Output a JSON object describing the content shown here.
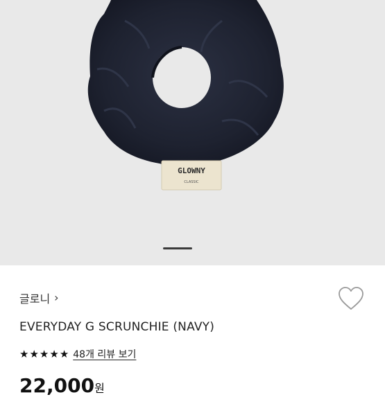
{
  "product_image": {
    "label_brand": "GLOWNY",
    "label_sub": "CLASSIC"
  },
  "carousel": {
    "current": 1
  },
  "brand": {
    "name": "글로니",
    "chevron": "›"
  },
  "wishlist": {
    "icon": "heart-outline-icon"
  },
  "product": {
    "title": "EVERYDAY G SCRUNCHIE (NAVY)"
  },
  "rating": {
    "stars": 5,
    "star_glyph": "★",
    "reviews_link": "48개 리뷰 보기"
  },
  "price": {
    "amount": "22,000",
    "currency": "원"
  },
  "colors": {
    "scrunchie": "#1e2230",
    "background": "#e9e9e9",
    "label": "#ece4cf"
  }
}
